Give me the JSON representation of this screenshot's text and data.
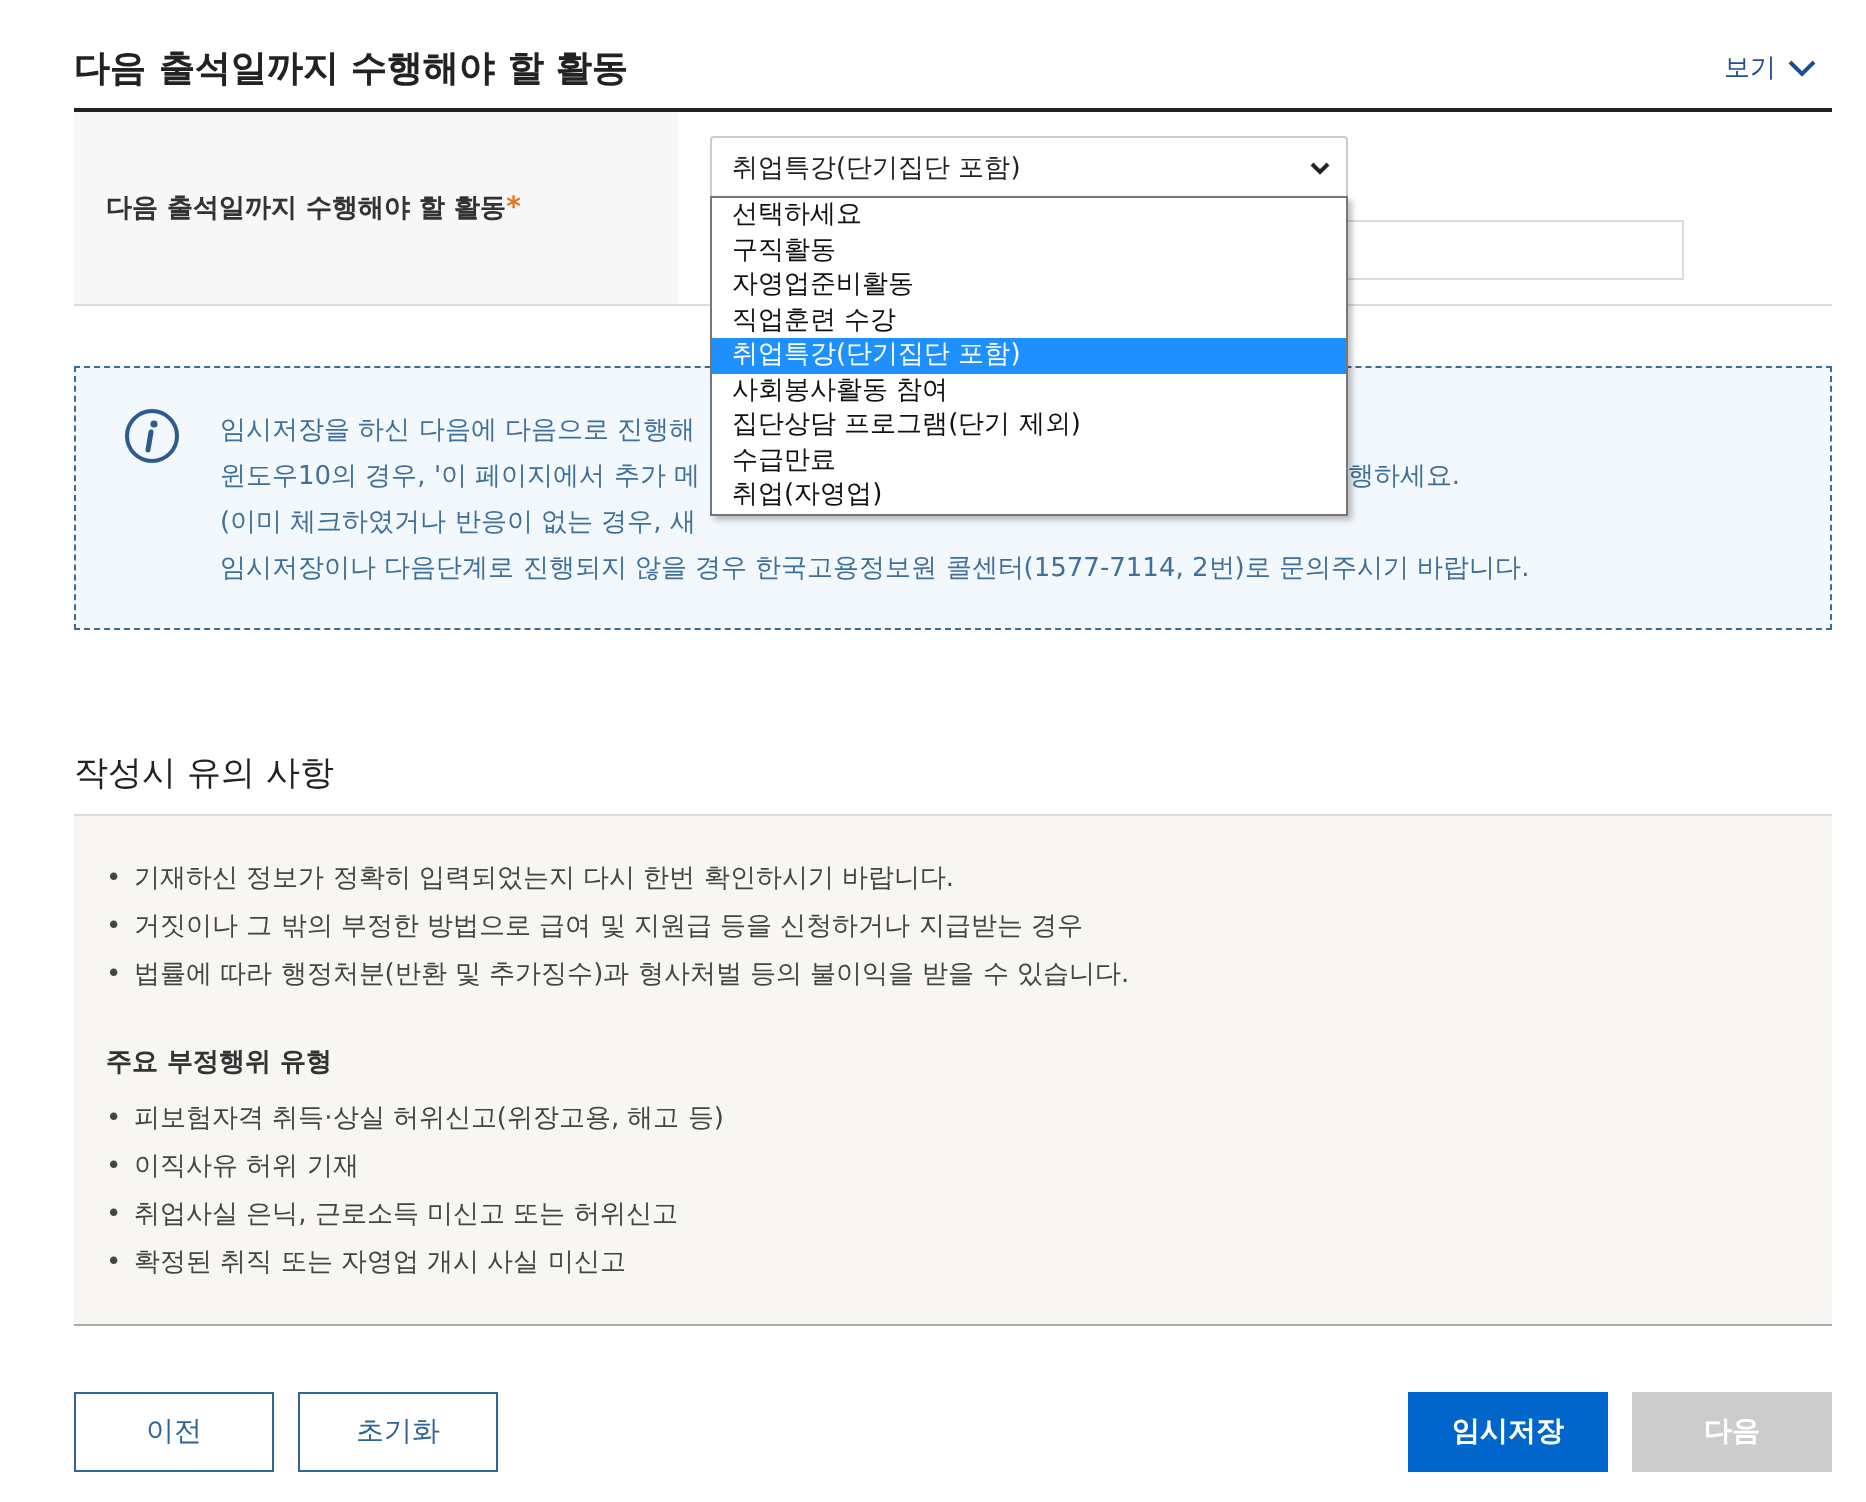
{
  "header": {
    "title": "다음 출석일까지 수행해야 할 활동",
    "toggle": {
      "label": "보기",
      "expanded": false
    }
  },
  "form": {
    "label": "다음 출석일까지 수행해야 할 활동",
    "required_mark": "*",
    "select": {
      "value": "취업특강(단기집단 포함)",
      "expanded": true,
      "options": [
        {
          "label": "선택하세요",
          "selected": false
        },
        {
          "label": "구직활동",
          "selected": false
        },
        {
          "label": "자영업준비활동",
          "selected": false
        },
        {
          "label": "직업훈련 수강",
          "selected": false
        },
        {
          "label": "취업특강(단기집단 포함)",
          "selected": true
        },
        {
          "label": "사회봉사활동 참여",
          "selected": false
        },
        {
          "label": "집단상담 프로그램(단기 제외)",
          "selected": false
        },
        {
          "label": "수급만료",
          "selected": false
        },
        {
          "label": "취업(자영업)",
          "selected": false
        }
      ]
    }
  },
  "info": {
    "lines": [
      {
        "text": "임시저장을 하신 다음에 다음으로 진행해"
      },
      {
        "text": "윈도우10의 경우, '이 페이지에서 추가 메",
        "after": "행하세요."
      },
      {
        "text": "(이미 체크하였거나 반응이 없는 경우, 새"
      },
      {
        "text": "임시저장이나 다음단계로 진행되지 않을 경우 한국고용정보원 콜센터(1577-7114, 2번)로 문의주시기 바랍니다."
      }
    ]
  },
  "notes": {
    "title": "작성시 유의 사항",
    "items": [
      {
        "marker": "•",
        "text": "기재하신 정보가 정확히 입력되었는지 다시 한번 확인하시기 바랍니다."
      },
      {
        "marker": "•",
        "text": "거짓이나 그 밖의 부정한 방법으로 급여 및 지원급 등을 신청하거나 지급받는 경우"
      },
      {
        "marker": "•",
        "text": "법률에 따라 행정처분(반환 및 추가징수)과 형사처벌 등의 불이익을 받을 수 있습니다."
      }
    ],
    "subtitle": "주요 부정행위 유형",
    "subitems": [
      {
        "marker": "•",
        "text": "피보험자격 취득·상실 허위신고(위장고용, 해고 등)"
      },
      {
        "marker": "•",
        "text": "이직사유 허위 기재"
      },
      {
        "marker": "•",
        "text": "취업사실 은닉, 근로소득 미신고 또는 허위신고"
      },
      {
        "marker": "•",
        "text": "확정된 취직 또는 자영업 개시 사실 미신고"
      }
    ]
  },
  "buttons": [
    {
      "label": "이전",
      "kind": "outline"
    },
    {
      "label": "초기화",
      "kind": "outline"
    },
    {
      "label": "임시저장",
      "kind": "primary",
      "disabled": false
    },
    {
      "label": "다음",
      "kind": "primary",
      "disabled": true
    }
  ]
}
